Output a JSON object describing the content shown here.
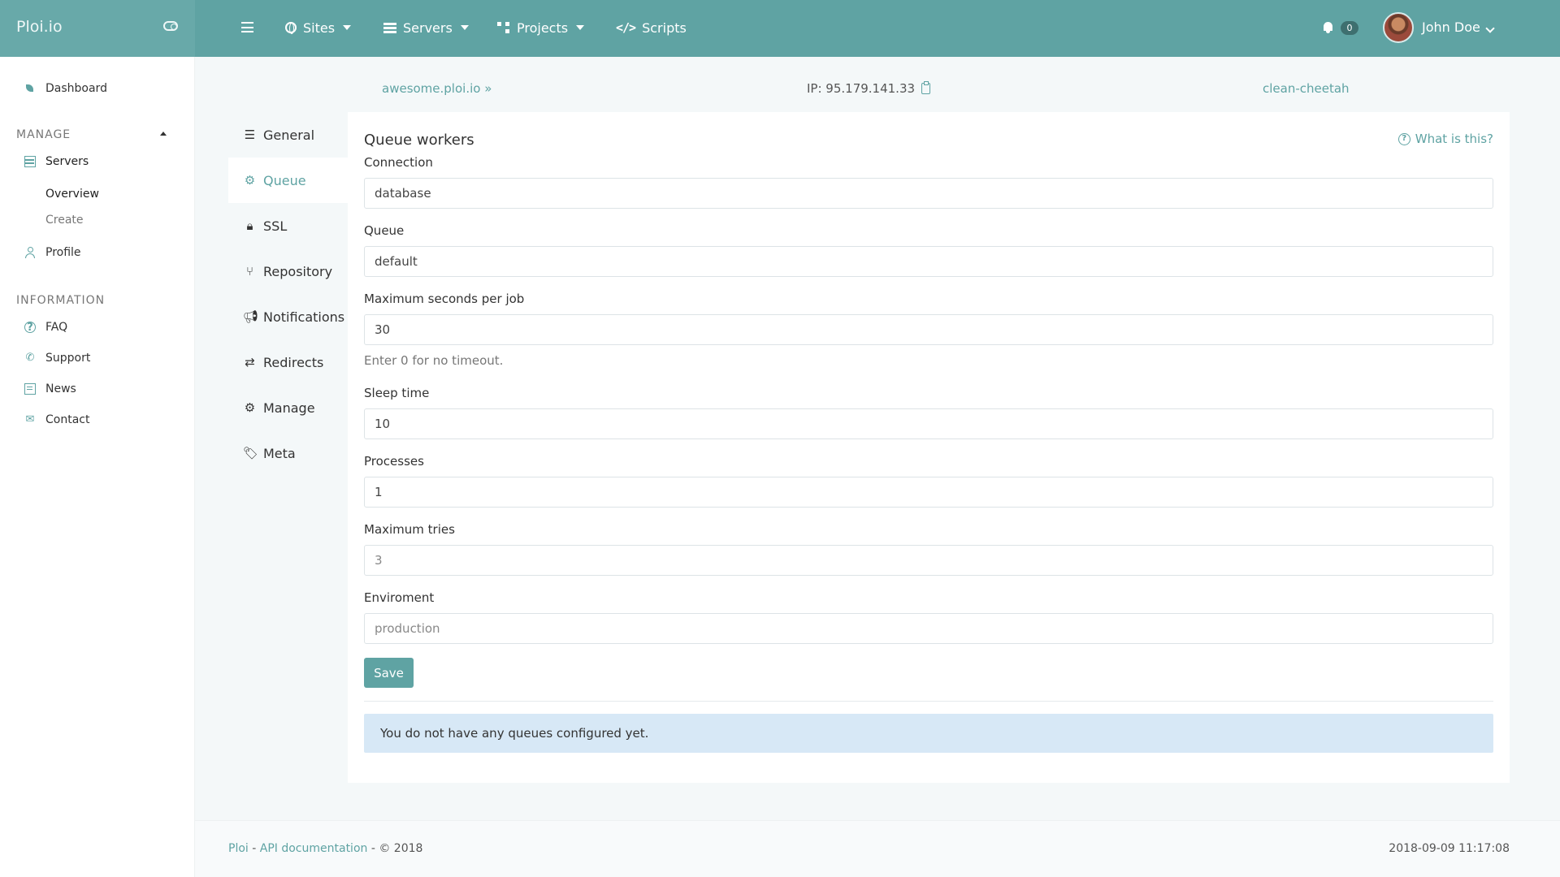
{
  "app": {
    "brand": "Ploi.io"
  },
  "topnav": {
    "sites": "Sites",
    "servers": "Servers",
    "projects": "Projects",
    "scripts": "Scripts",
    "notification_count": "0",
    "user_name": "John Doe"
  },
  "sidebar": {
    "dashboard": "Dashboard",
    "manage_heading": "MANAGE",
    "servers": "Servers",
    "overview": "Overview",
    "create": "Create",
    "profile": "Profile",
    "information_heading": "INFORMATION",
    "faq": "FAQ",
    "support": "Support",
    "news": "News",
    "contact": "Contact"
  },
  "header": {
    "site": "awesome.ploi.io",
    "site_suffix": "»",
    "ip": "IP: 95.179.141.33",
    "server_name": "clean-cheetah"
  },
  "tabs": [
    {
      "label": "General",
      "icon": "list-icon"
    },
    {
      "label": "Queue",
      "icon": "gear-icon",
      "active": true
    },
    {
      "label": "SSL",
      "icon": "lock-icon"
    },
    {
      "label": "Repository",
      "icon": "branch-icon"
    },
    {
      "label": "Notifications",
      "icon": "megaphone-icon"
    },
    {
      "label": "Redirects",
      "icon": "exchange-icon"
    },
    {
      "label": "Manage",
      "icon": "gears-icon"
    },
    {
      "label": "Meta",
      "icon": "tag-icon"
    }
  ],
  "form": {
    "title": "Queue workers",
    "help": "What is this?",
    "connection_label": "Connection",
    "connection_value": "database",
    "queue_label": "Queue",
    "queue_value": "default",
    "max_seconds_label": "Maximum seconds per job",
    "max_seconds_value": "30",
    "max_seconds_hint": "Enter 0 for no timeout.",
    "sleep_label": "Sleep time",
    "sleep_value": "10",
    "processes_label": "Processes",
    "processes_value": "1",
    "max_tries_label": "Maximum tries",
    "max_tries_placeholder": "3",
    "environment_label": "Enviroment",
    "environment_placeholder": "production",
    "save": "Save",
    "empty_notice": "You do not have any queues configured yet."
  },
  "footer": {
    "ploi_link": "Ploi",
    "sep1": " - ",
    "api_link": "API documentation",
    "copyright": " - © 2018",
    "timestamp": "2018-09-09 11:17:08"
  },
  "colors": {
    "accent": "#5fa3a3",
    "alert_bg": "#d7e8f6"
  }
}
